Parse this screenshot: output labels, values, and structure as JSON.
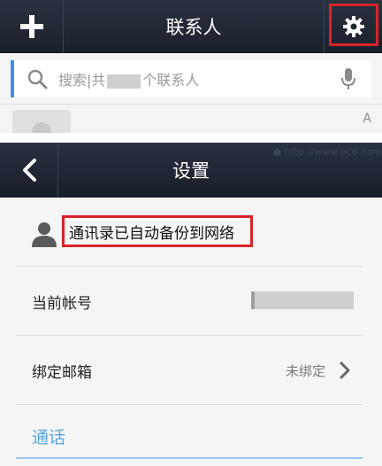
{
  "contacts": {
    "title": "联系人",
    "search": {
      "placeholder_prefix": "搜索|共",
      "placeholder_suffix": "个联系人"
    },
    "index_letter": "A"
  },
  "settings": {
    "title": "设置",
    "watermark": "● http://www.pc6.com",
    "backup_status": "通讯录已自动备份到网络",
    "current_account_label": "当前帐号",
    "bind_email_label": "绑定邮箱",
    "bind_email_value": "未绑定",
    "section_call": "通话"
  },
  "icons": {
    "add": "plus-icon",
    "settings": "gear-icon",
    "search": "search-icon",
    "mic": "microphone-icon",
    "back": "back-arrow-icon",
    "person": "person-icon",
    "chevron": "chevron-right-icon"
  },
  "colors": {
    "highlight": "#d8232a",
    "accent_blue": "#3d8ee8",
    "section_blue": "#5aa5e0",
    "bar_dark": "#1a202b"
  }
}
